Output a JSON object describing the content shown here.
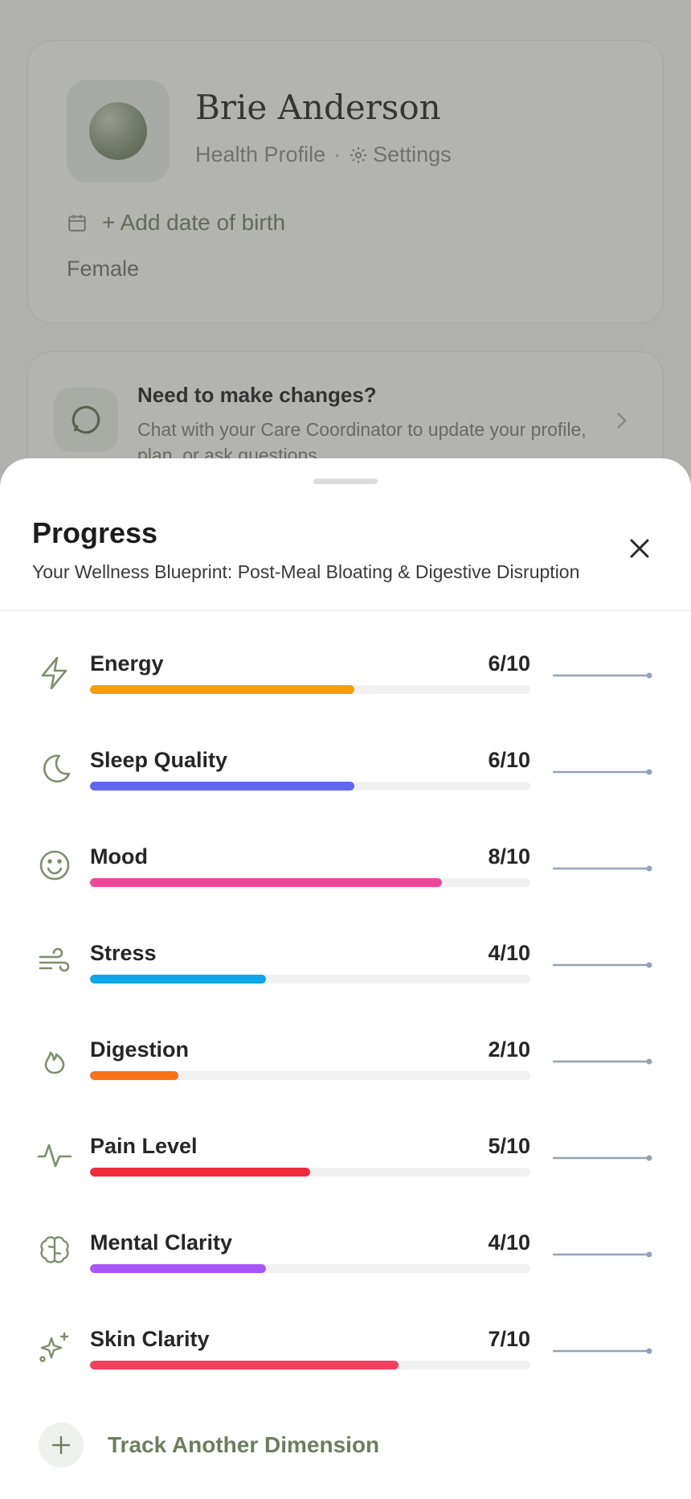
{
  "profile": {
    "name": "Brie Anderson",
    "subtitle": "Health Profile",
    "settings_label": "Settings",
    "add_dob": "+ Add date of birth",
    "gender": "Female"
  },
  "chat_card": {
    "title": "Need to make changes?",
    "description": "Chat with your Care Coordinator to update your profile, plan, or ask questions."
  },
  "sheet": {
    "title": "Progress",
    "subtitle": "Your Wellness Blueprint: Post-Meal Bloating & Digestive Disruption",
    "track_another": "Track Another Dimension"
  },
  "metrics": [
    {
      "label": "Energy",
      "score": "6/10",
      "value": 6,
      "color": "#f59e0b",
      "icon": "lightning-icon"
    },
    {
      "label": "Sleep Quality",
      "score": "6/10",
      "value": 6,
      "color": "#6366f1",
      "icon": "moon-icon"
    },
    {
      "label": "Mood",
      "score": "8/10",
      "value": 8,
      "color": "#ec4899",
      "icon": "smile-icon"
    },
    {
      "label": "Stress",
      "score": "4/10",
      "value": 4,
      "color": "#0ea5e9",
      "icon": "wind-icon"
    },
    {
      "label": "Digestion",
      "score": "2/10",
      "value": 2,
      "color": "#f97316",
      "icon": "flame-icon"
    },
    {
      "label": "Pain Level",
      "score": "5/10",
      "value": 5,
      "color": "#ef2b3c",
      "icon": "pulse-icon"
    },
    {
      "label": "Mental Clarity",
      "score": "4/10",
      "value": 4,
      "color": "#a855f7",
      "icon": "brain-icon"
    },
    {
      "label": "Skin Clarity",
      "score": "7/10",
      "value": 7,
      "color": "#f43f5e",
      "icon": "sparkle-icon"
    }
  ],
  "colors": {
    "accent": "#6d7e5f",
    "icon": "#7d8f6e",
    "sparkline": "#94a3b8"
  }
}
